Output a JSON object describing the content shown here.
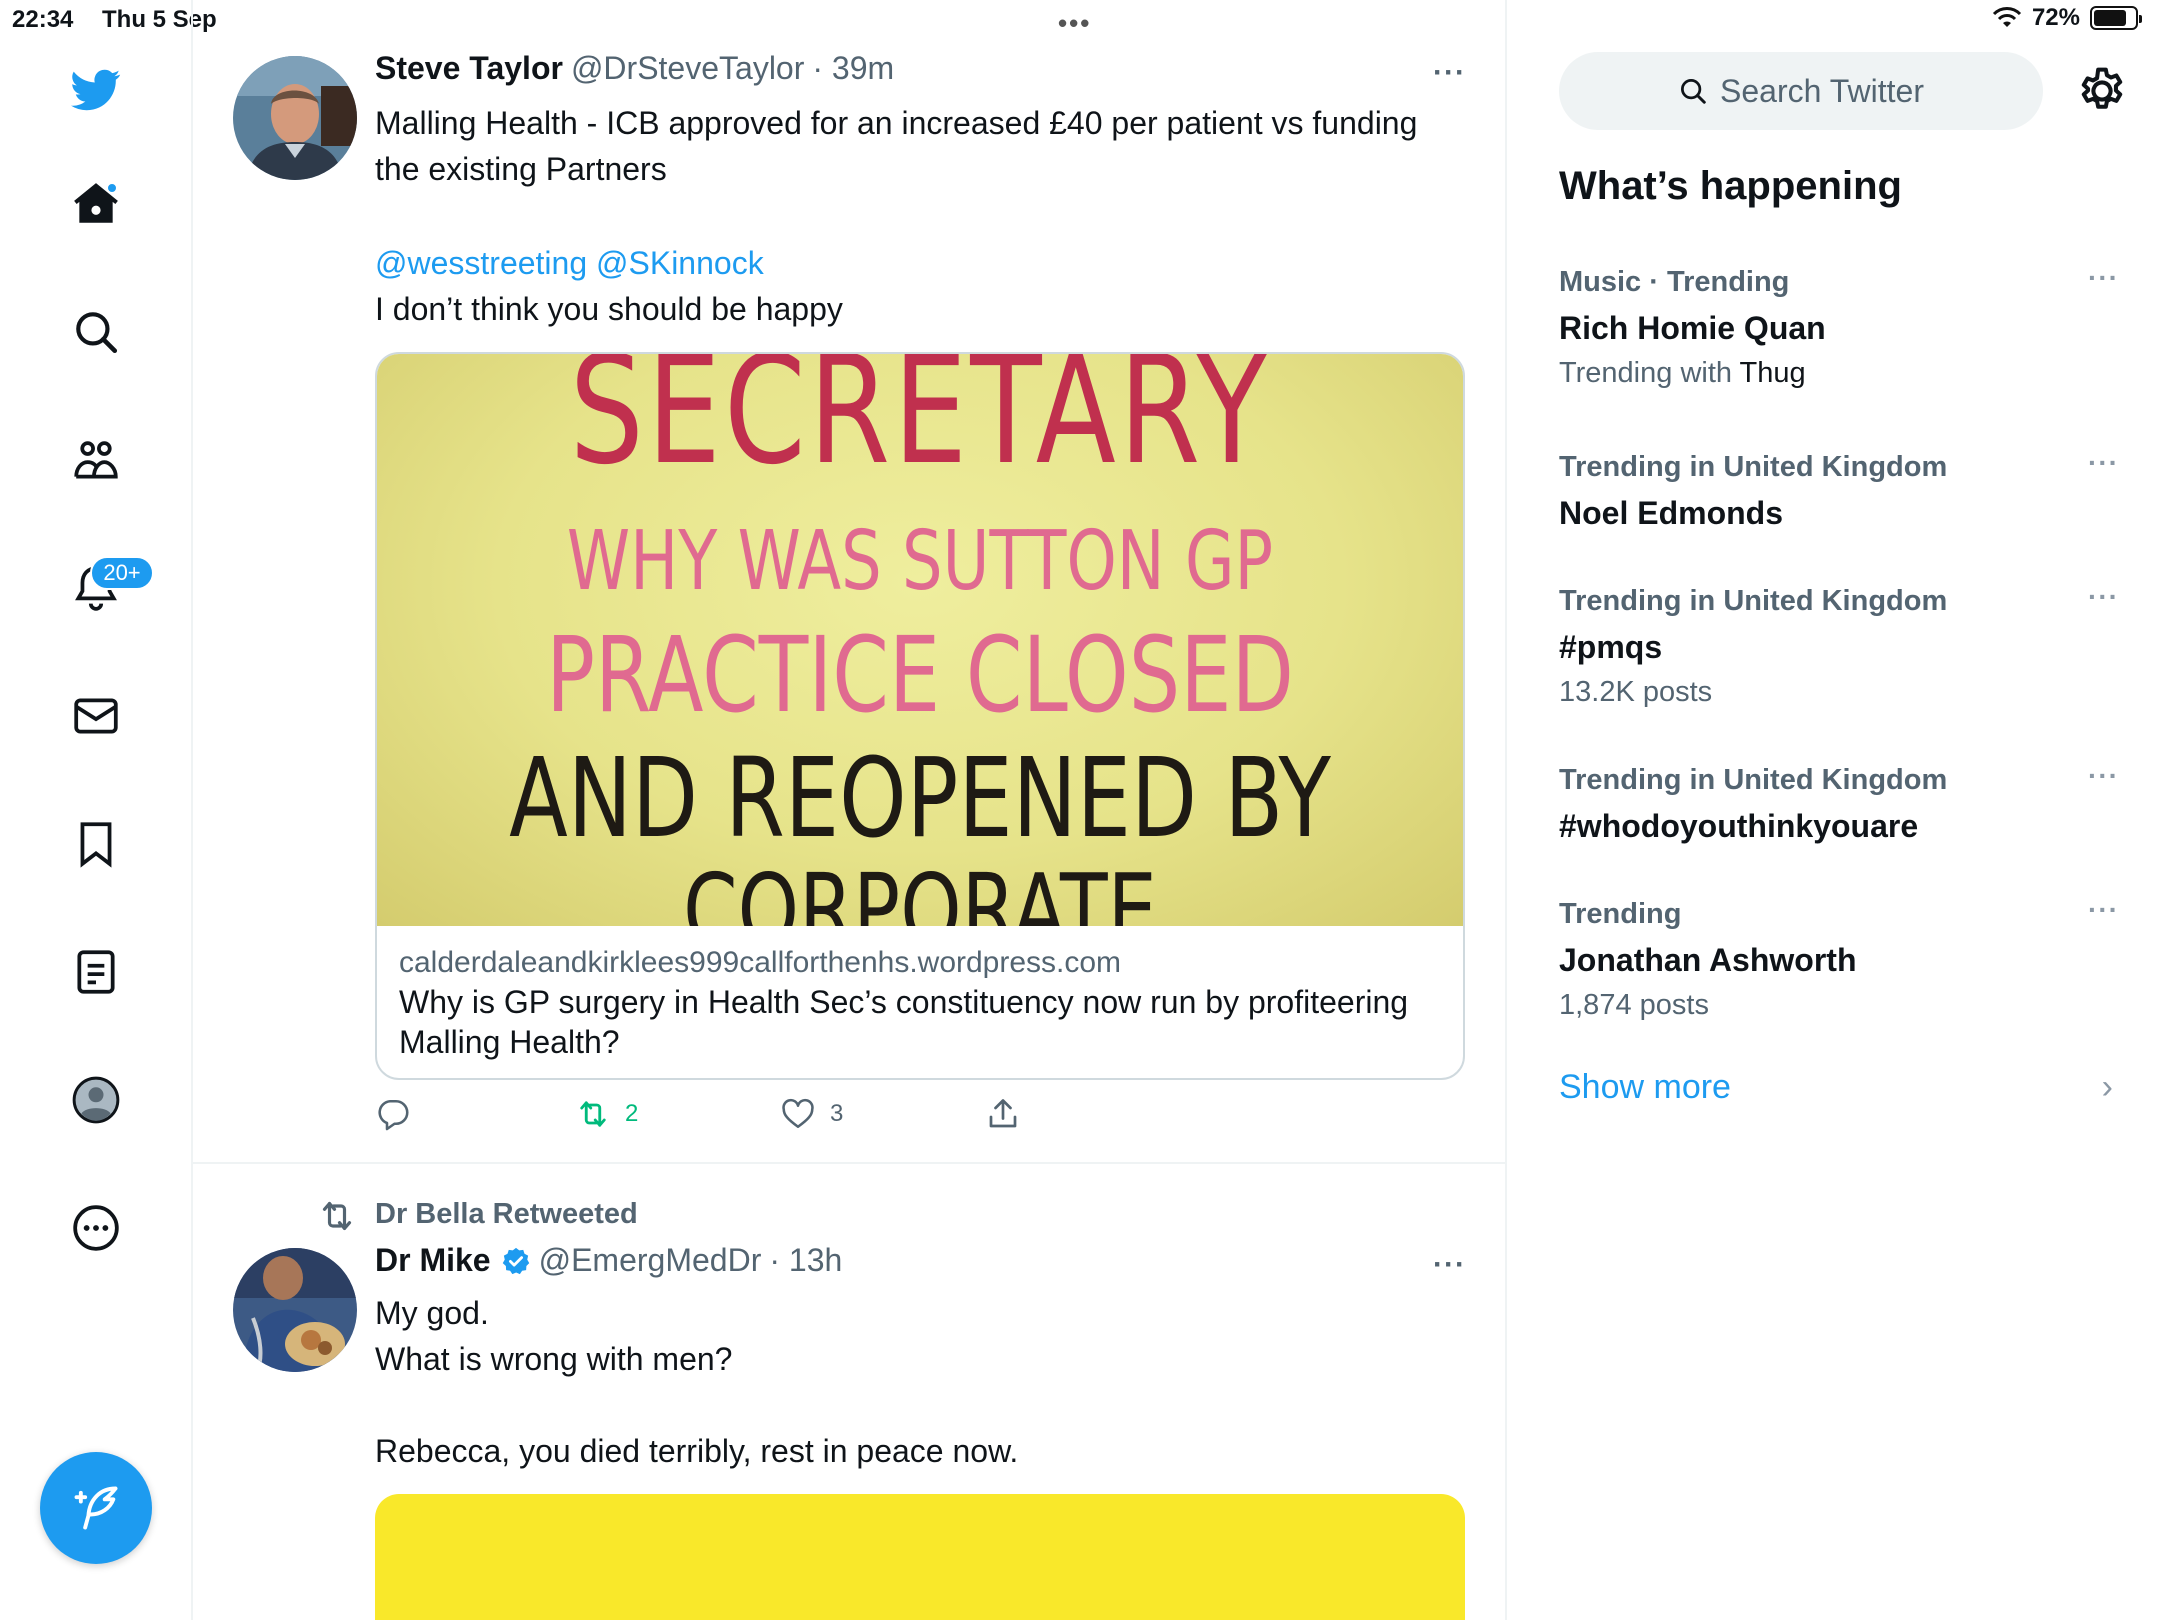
{
  "status_bar": {
    "time": "22:34",
    "date": "Thu 5 Sep",
    "battery": "72%",
    "battery_level": 0.72
  },
  "nav": {
    "notifications_badge": "20+"
  },
  "tweets": [
    {
      "name": "Steve Taylor",
      "handle": "@DrSteveTaylor",
      "time": "· 39m",
      "more": "···",
      "text_line1": "Malling Health - ICB approved for an increased £40 per patient vs funding the existing Partners",
      "mention1": "@wesstreeting",
      "mention2": "@SKinnock",
      "text_line2": "I don’t think you should be happy",
      "card": {
        "image_text": [
          "SECRETARY",
          "WHY WAS SUTTON GP",
          "PRACTICE CLOSED",
          "AND REOPENED BY",
          "CORPORATE"
        ],
        "domain": "calderdaleandkirklees999callforthenhs.wordpress.com",
        "title": "Why is GP surgery in Health Sec’s constituency now run by profiteering Malling Health?"
      },
      "retweets": "2",
      "likes": "3"
    },
    {
      "retweeted_by": "Dr Bella Retweeted",
      "name": "Dr Mike",
      "handle": "@EmergMedDr",
      "time": "· 13h",
      "more": "···",
      "line1": "My god.",
      "line2": "What is wrong with men?",
      "line3": "Rebecca, you died terribly, rest in peace now."
    }
  ],
  "sidebar": {
    "search_placeholder": "Search Twitter",
    "title": "What’s happening",
    "trends": [
      {
        "context": "Music · Trending",
        "name": "Rich Homie Quan",
        "sub_prefix": "Trending with ",
        "sub_highlight": "Thug"
      },
      {
        "context": "Trending in United Kingdom",
        "name": "Noel Edmonds"
      },
      {
        "context": "Trending in United Kingdom",
        "name": "#pmqs",
        "sub": "13.2K posts"
      },
      {
        "context": "Trending in United Kingdom",
        "name": "#whodoyouthinkyouare"
      },
      {
        "context": "Trending",
        "name": "Jonathan Ashworth",
        "sub": "1,874 posts"
      }
    ],
    "more": "···",
    "show_more": "Show more",
    "chevron": "›"
  },
  "colors": {
    "accent": "#1d9bf0",
    "retweet_green": "#00ba7c",
    "muted": "#536471"
  }
}
